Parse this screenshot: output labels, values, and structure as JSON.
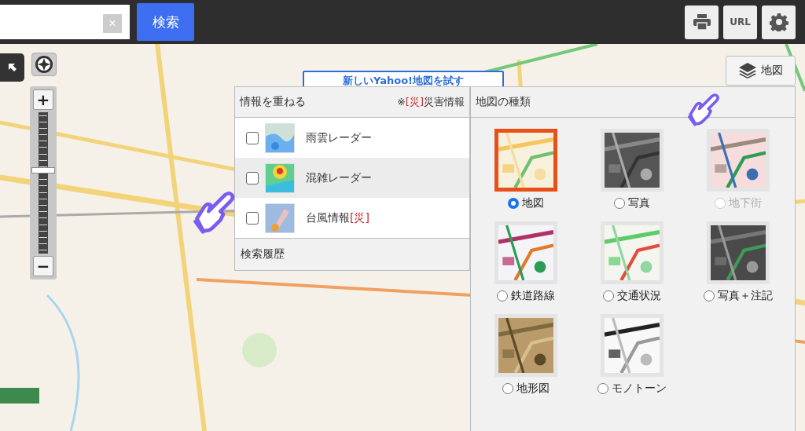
{
  "search": {
    "clear_label": "×",
    "button": "検索"
  },
  "toolbar": [
    {
      "kind": "print"
    },
    {
      "kind": "text",
      "label": "URL"
    },
    {
      "kind": "settings"
    }
  ],
  "zoom": {
    "plus": "+",
    "minus": "−",
    "level": 0.59
  },
  "promo_button": {
    "label": "新しいYahoo!地図を試す"
  },
  "layer_button": {
    "label": "地図"
  },
  "overlay_panel": {
    "title": "情報を重ねる",
    "note": {
      "prefix": "※",
      "tag": "[災]",
      "suffix": "災害情報"
    },
    "items": [
      {
        "label": "雨雲レーダー",
        "checked": false,
        "highlighted": false
      },
      {
        "label": "混雑レーダー",
        "checked": false,
        "highlighted": true
      },
      {
        "label": "台風情報",
        "tag": "[災]",
        "checked": false,
        "highlighted": false
      }
    ],
    "footer": "検索履歴"
  },
  "map_types": {
    "title": "地図の種類",
    "items": [
      {
        "label": "地図",
        "selected": true,
        "disabled": false
      },
      {
        "label": "写真",
        "selected": false,
        "disabled": false
      },
      {
        "label": "地下街",
        "selected": false,
        "disabled": true
      },
      {
        "label": "鉄道路線",
        "selected": false,
        "disabled": false
      },
      {
        "label": "交通状況",
        "selected": false,
        "disabled": false
      },
      {
        "label": "写真＋注記",
        "selected": false,
        "disabled": false
      },
      {
        "label": "地形図",
        "selected": false,
        "disabled": false
      },
      {
        "label": "モノトーン",
        "selected": false,
        "disabled": false
      }
    ]
  }
}
